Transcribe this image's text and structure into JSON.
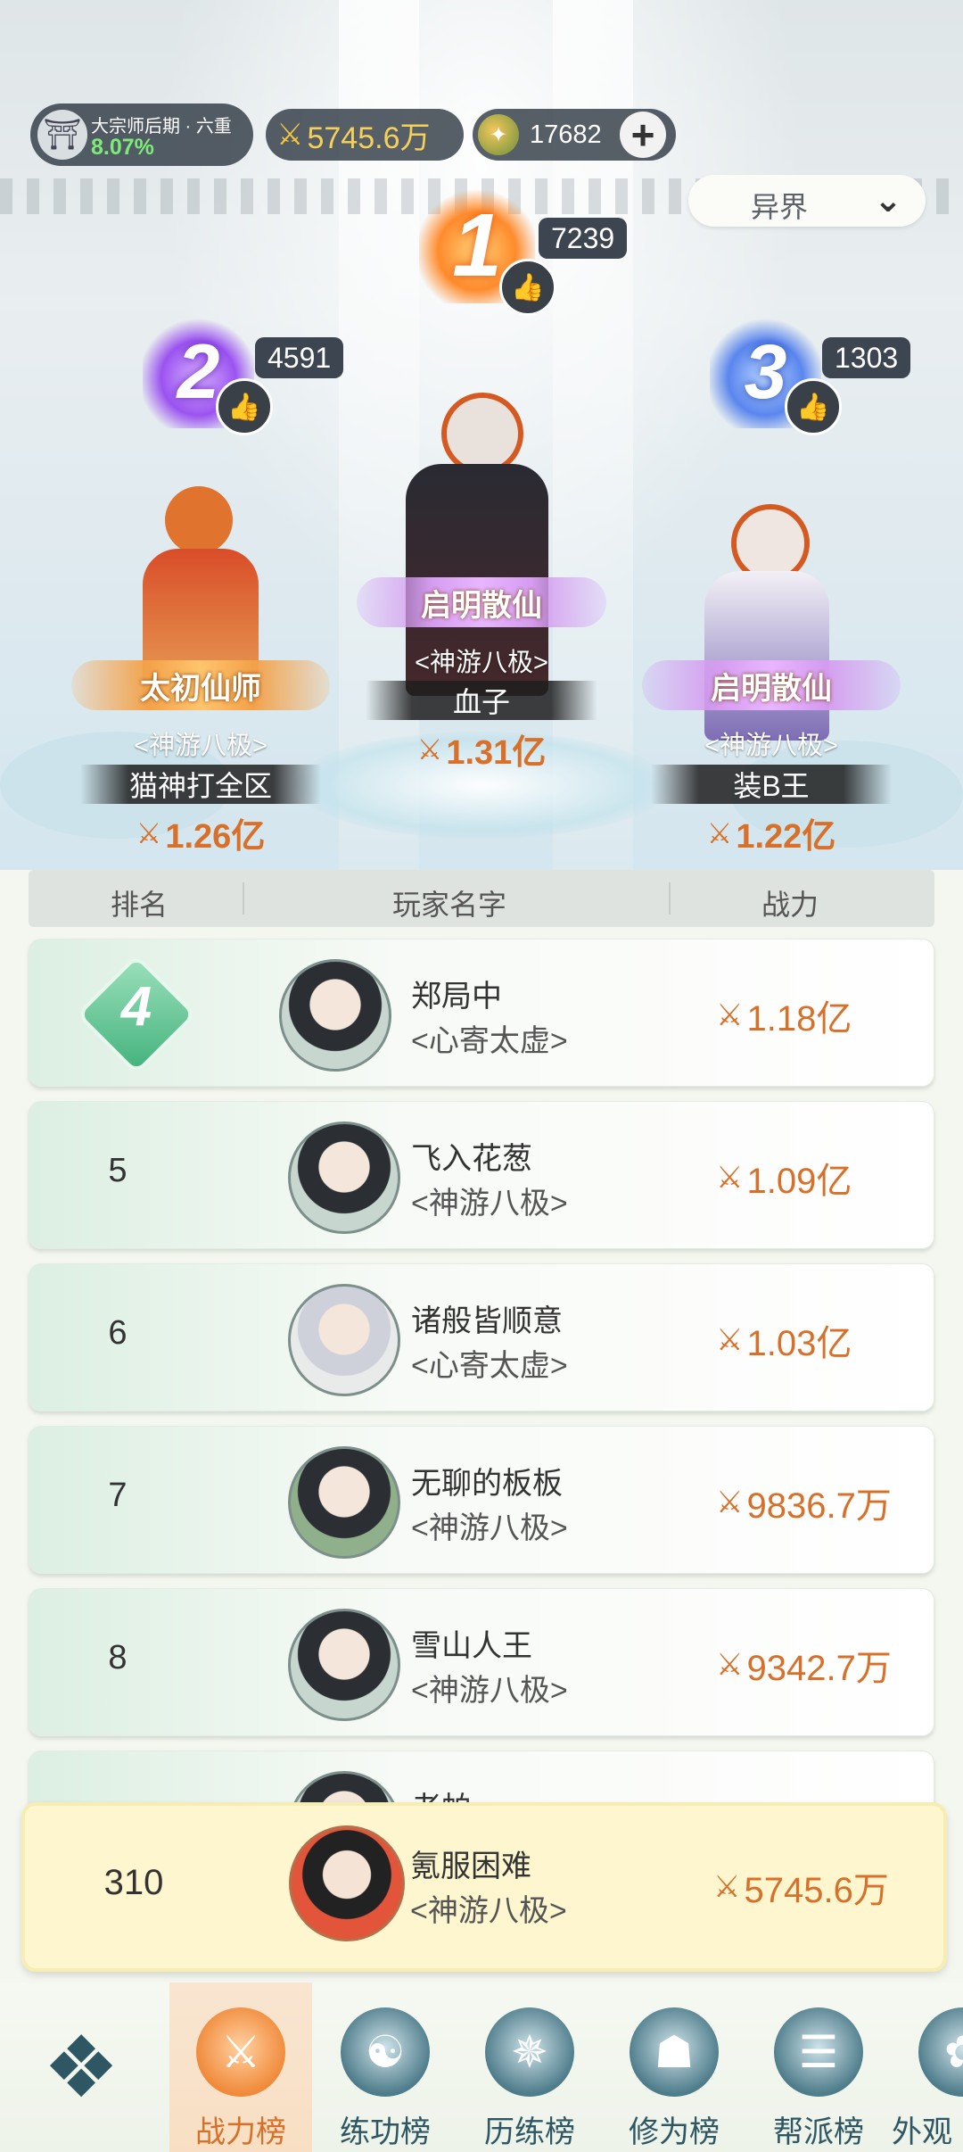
{
  "top_bar": {
    "cultivation_title": "大宗师后期 · 六重",
    "cultivation_progress": "8.07%",
    "power_total": "5745.6万",
    "jade_count": "17682",
    "world_select": "异界"
  },
  "podium": {
    "first": {
      "rank": "1",
      "likes": "7239",
      "title": "启明散仙",
      "realm": "<神游八极>",
      "name": "血子",
      "power": "1.31亿"
    },
    "second": {
      "rank": "2",
      "likes": "4591",
      "title": "太初仙师",
      "realm": "<神游八极>",
      "name": "猫神打全区",
      "power": "1.26亿"
    },
    "third": {
      "rank": "3",
      "likes": "1303",
      "title": "启明散仙",
      "realm": "<神游八极>",
      "name": "装B王",
      "power": "1.22亿"
    }
  },
  "table_header": {
    "rank": "排名",
    "name": "玩家名字",
    "power": "战力"
  },
  "rows": [
    {
      "rank": "4",
      "name": "郑局中",
      "realm": "<心寄太虚>",
      "power": "1.18亿"
    },
    {
      "rank": "5",
      "name": "飞入花葱",
      "realm": "<神游八极>",
      "power": "1.09亿"
    },
    {
      "rank": "6",
      "name": "诸般皆顺意",
      "realm": "<心寄太虚>",
      "power": "1.03亿"
    },
    {
      "rank": "7",
      "name": "无聊的板板",
      "realm": "<神游八极>",
      "power": "9836.7万"
    },
    {
      "rank": "8",
      "name": "雪山人王",
      "realm": "<神游八极>",
      "power": "9342.7万"
    },
    {
      "rank": "",
      "name": "老帕",
      "realm": "",
      "power": ""
    }
  ],
  "self_row": {
    "rank": "310",
    "name": "氪服困难",
    "realm": "<神游八极>",
    "power": "5745.6万"
  },
  "nav": {
    "tabs": [
      {
        "label": "战力榜",
        "active": true
      },
      {
        "label": "练功榜",
        "active": false
      },
      {
        "label": "历练榜",
        "active": false
      },
      {
        "label": "修为榜",
        "active": false
      },
      {
        "label": "帮派榜",
        "active": false
      },
      {
        "label": "外观",
        "active": false
      }
    ]
  },
  "icons": {
    "power": "crossed-swords-icon",
    "like": "thumbs-up-icon",
    "jade": "jade-coin-icon",
    "menu": "diamond-menu-icon",
    "dropdown": "chevron-down-icon"
  },
  "colors": {
    "power_text": "#d8702a",
    "accent_green": "#44b27d",
    "self_row_bg": "#fdf6cf"
  }
}
